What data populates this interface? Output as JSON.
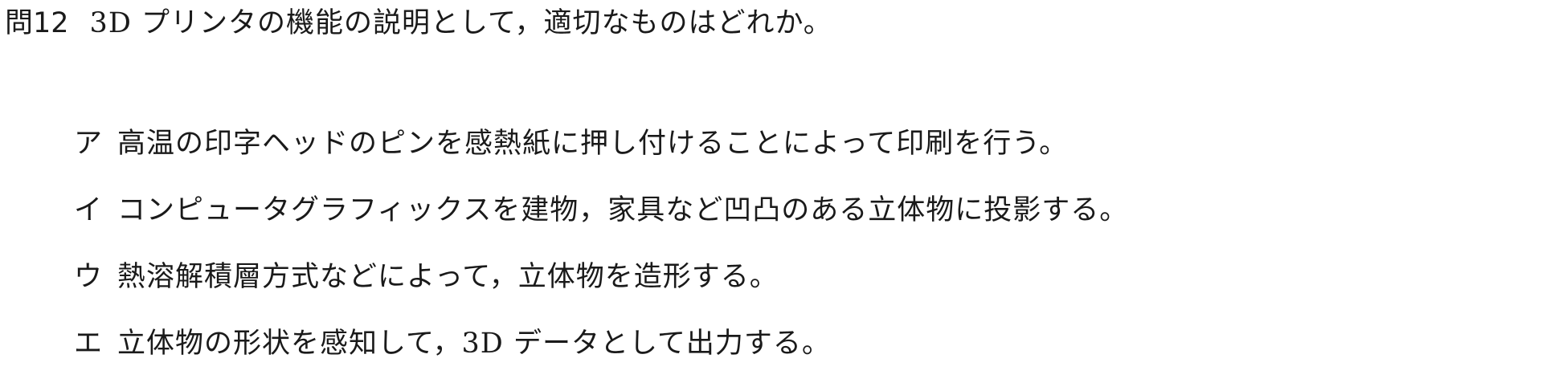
{
  "question": {
    "number": "問12",
    "text": "3D プリンタの機能の説明として，適切なものはどれか。"
  },
  "choices": [
    {
      "letter": "ア",
      "text": "高温の印字ヘッドのピンを感熱紙に押し付けることによって印刷を行う。"
    },
    {
      "letter": "イ",
      "text": "コンピュータグラフィックスを建物，家具など凹凸のある立体物に投影する。"
    },
    {
      "letter": "ウ",
      "text": "熱溶解積層方式などによって，立体物を造形する。"
    },
    {
      "letter": "エ",
      "text": "立体物の形状を感知して，3D データとして出力する。"
    }
  ]
}
